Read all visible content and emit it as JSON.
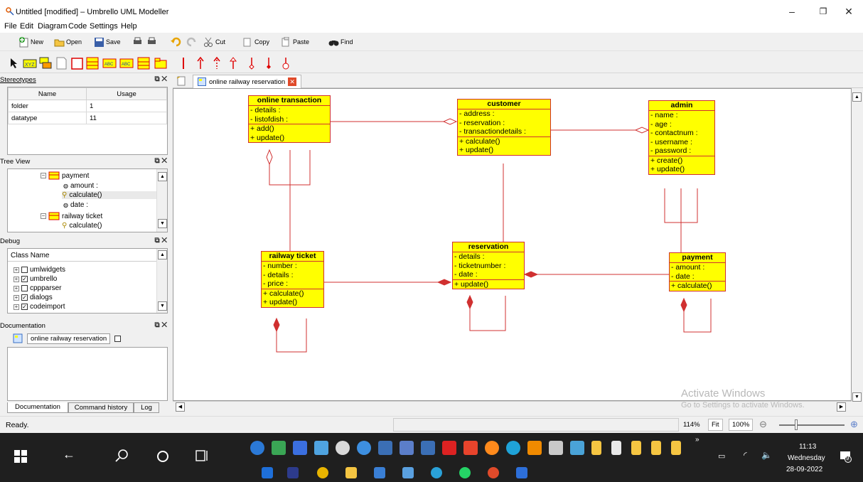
{
  "window": {
    "title": "Untitled [modified] – Umbrello UML Modeller",
    "controls": [
      "–",
      "❐",
      "✕"
    ]
  },
  "menu": [
    "File",
    "Edit",
    "Diagram",
    "Code",
    "Settings",
    "Help"
  ],
  "toolbar": {
    "new": "New",
    "open": "Open",
    "save": "Save",
    "cut": "Cut",
    "copy": "Copy",
    "paste": "Paste",
    "find": "Find"
  },
  "stereotypes": {
    "title": "Stereotypes",
    "columns": [
      "Name",
      "Usage"
    ],
    "rows": [
      [
        "folder",
        "1"
      ],
      [
        "datatype",
        "11"
      ]
    ]
  },
  "treeview": {
    "title": "Tree View",
    "items": [
      "payment",
      "amount :",
      "calculate()",
      "date :",
      "railway ticket",
      "calculate()"
    ]
  },
  "debug": {
    "title": "Debug",
    "header": "Class Name",
    "items": [
      {
        "label": "umlwidgets",
        "checked": false
      },
      {
        "label": "umbrello",
        "checked": true
      },
      {
        "label": "cppparser",
        "checked": false
      },
      {
        "label": "dialogs",
        "checked": true
      },
      {
        "label": "codeimport",
        "checked": true
      }
    ]
  },
  "documentation": {
    "title": "Documentation",
    "item": "online railway reservation"
  },
  "diagram_tab": "online railway reservation",
  "classes": {
    "online_transaction": {
      "name": "online transaction",
      "attrs": [
        "- details :",
        "- listofdish :"
      ],
      "ops": [
        "+ add()",
        "+ update()"
      ]
    },
    "customer": {
      "name": "customer",
      "attrs": [
        "- address :",
        "- reservation :",
        "- transactiondetails :"
      ],
      "ops": [
        "+ calculate()",
        "+ update()"
      ]
    },
    "admin": {
      "name": "admin",
      "attrs": [
        "- name :",
        "- age :",
        "- contactnum :",
        "- username :",
        "- password :"
      ],
      "ops": [
        "+ create()",
        "+ update()"
      ]
    },
    "railway_ticket": {
      "name": "railway ticket",
      "attrs": [
        "- number :",
        "- details :",
        "- price :"
      ],
      "ops": [
        "+ calculate()",
        "+ update()"
      ]
    },
    "reservation": {
      "name": "reservation",
      "attrs": [
        "- details :",
        "- ticketnumber :",
        "- date :"
      ],
      "ops": [
        "+ update()"
      ]
    },
    "payment": {
      "name": "payment",
      "attrs": [
        "- amount :",
        "- date :"
      ],
      "ops": [
        "+ calculate()"
      ]
    }
  },
  "watermark": {
    "line1": "Activate Windows",
    "line2": "Go to Settings to activate Windows."
  },
  "bottom_tabs": [
    "Documentation",
    "Command history",
    "Log"
  ],
  "status": {
    "text": "Ready.",
    "zoom": "114%",
    "fit": "Fit",
    "hundred": "100%"
  },
  "taskbar": {
    "time": "11:13",
    "day": "Wednesday",
    "date": "28-09-2022",
    "notification_count": "9"
  },
  "colors": {
    "uml_fill": "#ffff00",
    "uml_border": "#d03030",
    "taskbar": "#1f1f1f"
  }
}
